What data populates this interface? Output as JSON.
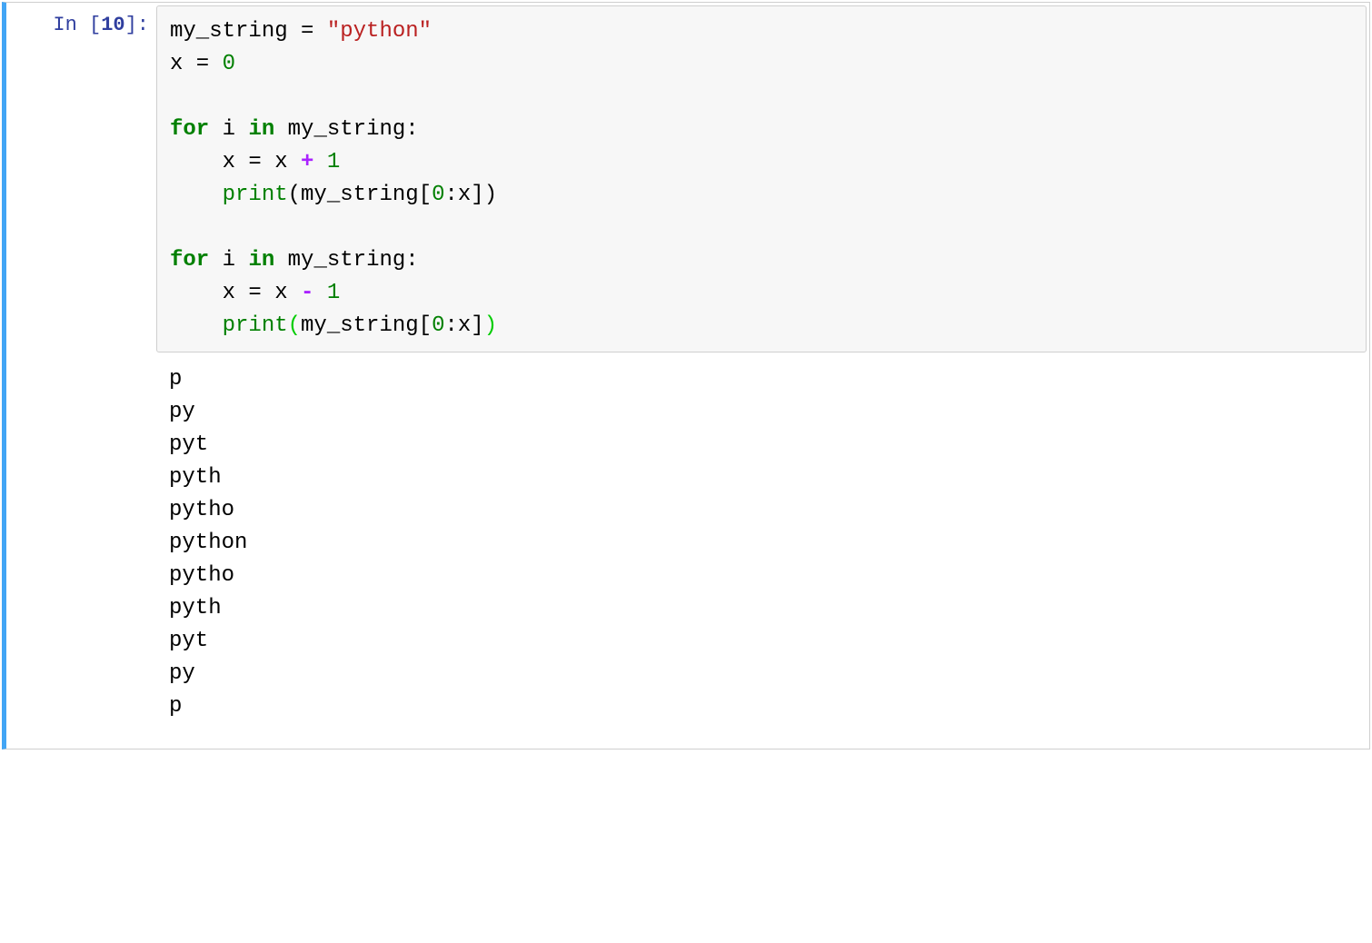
{
  "cell": {
    "prompt_prefix": "In [",
    "execution_count": "10",
    "prompt_suffix": "]:",
    "code": {
      "line1_var": "my_string",
      "line1_eq": " = ",
      "line1_str": "\"python\"",
      "line2_var": "x",
      "line2_eq": " = ",
      "line2_num": "0",
      "blank1": "",
      "line4_for": "for",
      "line4_sp1": " ",
      "line4_i": "i",
      "line4_sp2": " ",
      "line4_in": "in",
      "line4_sp3": " ",
      "line4_var": "my_string",
      "line4_colon": ":",
      "line5_indent": "    ",
      "line5_x": "x",
      "line5_eq": " = ",
      "line5_x2": "x",
      "line5_sp": " ",
      "line5_op": "+",
      "line5_sp2": " ",
      "line5_num": "1",
      "line6_indent": "    ",
      "line6_print": "print",
      "line6_lp": "(",
      "line6_var": "my_string",
      "line6_lb": "[",
      "line6_num": "0",
      "line6_colon": ":",
      "line6_x": "x",
      "line6_rb": "]",
      "line6_rp": ")",
      "blank2": "    ",
      "line8_for": "for",
      "line8_sp1": " ",
      "line8_i": "i",
      "line8_sp2": " ",
      "line8_in": "in",
      "line8_sp3": " ",
      "line8_var": "my_string",
      "line8_colon": ":",
      "line9_indent": "    ",
      "line9_x": "x",
      "line9_eq": " = ",
      "line9_x2": "x",
      "line9_sp": " ",
      "line9_op": "-",
      "line9_sp2": " ",
      "line9_num": "1",
      "line10_indent": "    ",
      "line10_print": "print",
      "line10_lp": "(",
      "line10_var": "my_string",
      "line10_lb": "[",
      "line10_num": "0",
      "line10_colon": ":",
      "line10_x": "x",
      "line10_rb": "]",
      "line10_rp": ")"
    },
    "output": "p\npy\npyt\npyth\npytho\npython\npytho\npyth\npyt\npy\np\n"
  }
}
